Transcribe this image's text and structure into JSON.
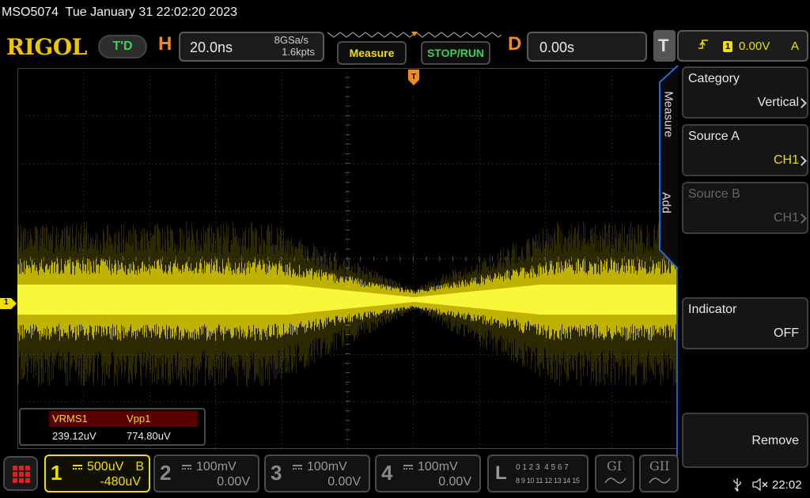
{
  "title": "MSO5074  Tue January 31 22:02:20 2023",
  "brand": {
    "logo": "RIGOL",
    "mode": "T'D"
  },
  "horizontal": {
    "label": "H",
    "timebase": "20.0ns",
    "sample_rate": "8GSa/s",
    "memory_depth": "1.6kpts"
  },
  "buttons": {
    "measure": "Measure",
    "stop_run": "STOP/RUN"
  },
  "delay": {
    "label": "D",
    "value": "0.00s"
  },
  "trigger": {
    "label": "T",
    "channel": "1",
    "level": "0.00V",
    "mode": "A"
  },
  "side_tabs": {
    "measure": "Measure",
    "add": "Add"
  },
  "menu": [
    {
      "key": "Category",
      "value": "Vertical",
      "enabled": true
    },
    {
      "key": "Source A",
      "value": "CH1",
      "enabled": true
    },
    {
      "key": "Source B",
      "value": "CH1",
      "enabled": false
    },
    {
      "key": "Indicator",
      "value": "OFF",
      "enabled": true
    },
    {
      "key": "Remove",
      "value": "",
      "enabled": true
    }
  ],
  "measurements": {
    "headers": [
      "VRMS1",
      "Vpp1"
    ],
    "values": [
      "239.12uV",
      "774.80uV"
    ]
  },
  "channel_marker": "1",
  "channels": [
    {
      "num": "1",
      "scale": "500uV",
      "coupling": "B",
      "offset": "-480uV",
      "color": "#f0e000",
      "active": true
    },
    {
      "num": "2",
      "scale": "100mV",
      "offset": "0.00V",
      "color": "#888888",
      "active": false
    },
    {
      "num": "3",
      "scale": "100mV",
      "offset": "0.00V",
      "color": "#888888",
      "active": false
    },
    {
      "num": "4",
      "scale": "100mV",
      "offset": "0.00V",
      "color": "#888888",
      "active": false
    }
  ],
  "logic": {
    "label": "L",
    "row1": "0 1 2 3  4 5 6 7",
    "row2": "8 9 10 11 12 13 14 15"
  },
  "decoders": [
    "GI",
    "GII"
  ],
  "status": {
    "time": "22:02"
  },
  "colors": {
    "ch1": "#f0e000",
    "accent_orange": "#f08a24",
    "accent_green": "#39d353",
    "side_border": "#1f5fbf"
  }
}
